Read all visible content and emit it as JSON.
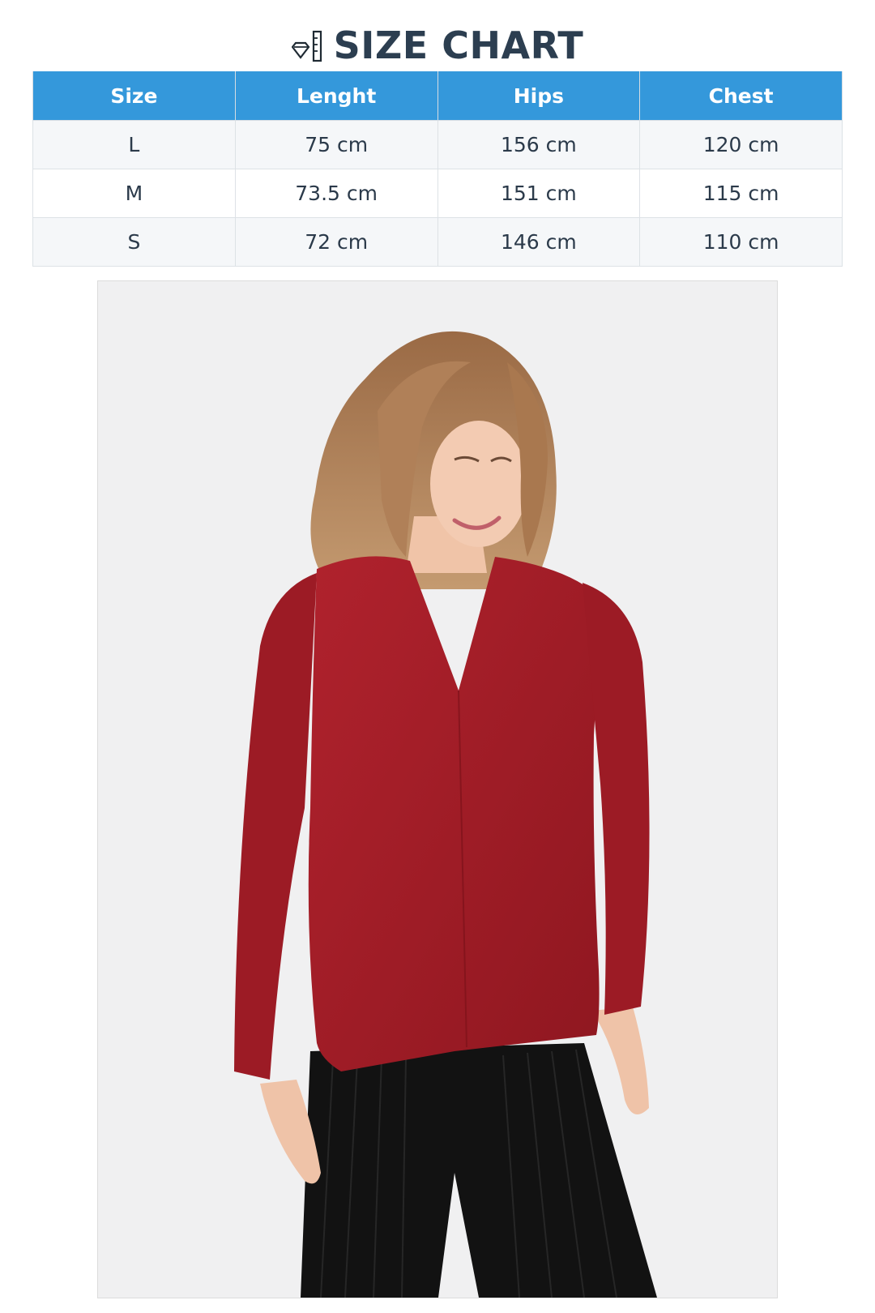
{
  "header": {
    "title": "SIZE CHART",
    "icon": "ruler-diamond-icon"
  },
  "table": {
    "columns": [
      "Size",
      "Lenght",
      "Hips",
      "Chest"
    ],
    "rows": [
      [
        "L",
        "75 cm",
        "156 cm",
        "120 cm"
      ],
      [
        "M",
        "73.5 cm",
        "151 cm",
        "115 cm"
      ],
      [
        "S",
        "72 cm",
        "146 cm",
        "110 cm"
      ]
    ]
  },
  "colors": {
    "header_bg": "#3498db",
    "title": "#2c3e50",
    "garment": "#a61d27",
    "photo_bg": "#f0f0f1"
  }
}
